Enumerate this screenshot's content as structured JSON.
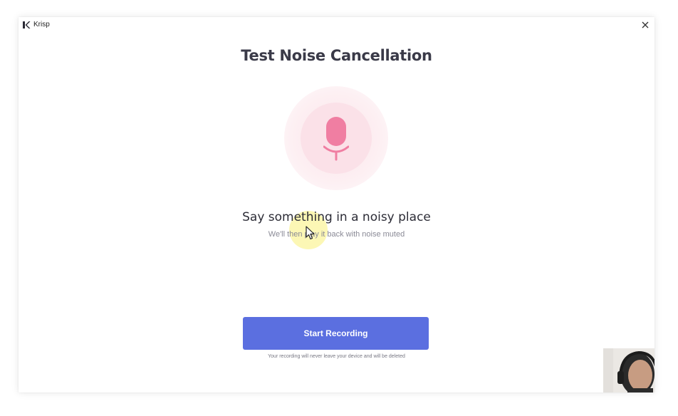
{
  "app": {
    "name": "Krisp",
    "logo": "krisp-logo-icon"
  },
  "window": {
    "close_icon": "close-icon"
  },
  "main": {
    "title": "Test Noise Cancellation",
    "mic_icon": "microphone-icon",
    "headline": "Say something in a noisy place",
    "subline": "We'll then play it back with noise muted",
    "start_button_label": "Start Recording",
    "privacy_note": "Your recording will never leave your device and will be deleted"
  },
  "colors": {
    "accent": "#5b6fe0",
    "mic": "#f07ea2",
    "mic_glow": "#fbe1e8",
    "title_text": "#3a3a48"
  },
  "overlay": {
    "cursor_icon": "mouse-pointer-icon",
    "webcam": "webcam-overlay"
  }
}
